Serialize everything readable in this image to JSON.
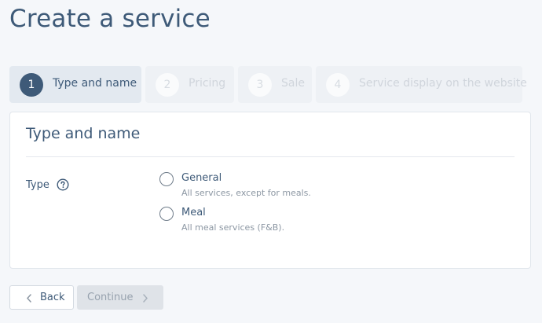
{
  "page": {
    "title": "Create a service"
  },
  "steps": [
    {
      "number": "1",
      "label": "Type and name",
      "state": "active"
    },
    {
      "number": "2",
      "label": "Pricing",
      "state": "inactive"
    },
    {
      "number": "3",
      "label": "Sale",
      "state": "inactive"
    },
    {
      "number": "4",
      "label": "Service display on the website",
      "state": "inactive"
    }
  ],
  "section": {
    "title": "Type and name"
  },
  "type_field": {
    "label": "Type",
    "help_icon": "question-circle-icon",
    "options": [
      {
        "title": "General",
        "description": "All services, except for meals.",
        "selected": false
      },
      {
        "title": "Meal",
        "description": "All meal services (F&B).",
        "selected": false
      }
    ]
  },
  "footer": {
    "back_label": "Back",
    "back_icon": "chevron-left-icon",
    "continue_label": "Continue",
    "continue_icon": "chevron-right-icon",
    "continue_disabled": true
  },
  "colors": {
    "accent": "#3e5a78",
    "background": "#f5f7fa",
    "muted_text": "#8c97a3"
  }
}
